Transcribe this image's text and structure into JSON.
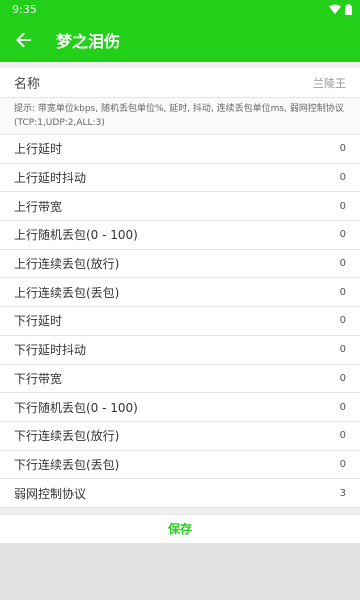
{
  "status_bar": {
    "time": "9:35",
    "icons": [
      "wifi-icon",
      "battery-icon"
    ]
  },
  "app_bar": {
    "back_icon": "arrow-left-icon",
    "title": "梦之泪伤"
  },
  "name_field": {
    "label": "名称",
    "value": "兰陵王"
  },
  "tip": "提示: 带宽单位kbps, 随机丢包单位%, 延时, 抖动, 连续丢包单位ms, 弱网控制协议(TCP:1,UDP:2,ALL:3)",
  "rows": [
    {
      "label": "上行延时",
      "value": "0"
    },
    {
      "label": "上行延时抖动",
      "value": "0"
    },
    {
      "label": "上行带宽",
      "value": "0"
    },
    {
      "label": "上行随机丢包(0 - 100)",
      "value": "0"
    },
    {
      "label": "上行连续丢包(放行)",
      "value": "0"
    },
    {
      "label": "上行连续丢包(丢包)",
      "value": "0"
    },
    {
      "label": "下行延时",
      "value": "0"
    },
    {
      "label": "下行延时抖动",
      "value": "0"
    },
    {
      "label": "下行带宽",
      "value": "0"
    },
    {
      "label": "下行随机丢包(0 - 100)",
      "value": "0"
    },
    {
      "label": "下行连续丢包(放行)",
      "value": "0"
    },
    {
      "label": "下行连续丢包(丢包)",
      "value": "0"
    },
    {
      "label": "弱网控制协议",
      "value": "3"
    }
  ],
  "save_label": "保存",
  "colors": {
    "accent": "#22d01a",
    "background": "#f0f0f0"
  }
}
